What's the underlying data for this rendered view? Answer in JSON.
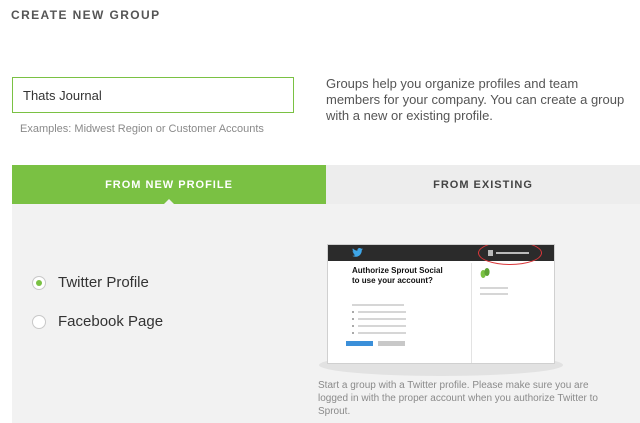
{
  "page": {
    "title": "CREATE NEW GROUP"
  },
  "group_name": {
    "value": "Thats Journal",
    "hint": "Examples: Midwest Region or Customer Accounts"
  },
  "description": "Groups help you organize profiles and team members for your company. You can create a group with a new or existing profile.",
  "tabs": [
    {
      "label": "FROM NEW PROFILE",
      "active": true
    },
    {
      "label": "FROM EXISTING",
      "active": false
    }
  ],
  "profile_options": [
    {
      "label": "Twitter Profile",
      "selected": true
    },
    {
      "label": "Facebook Page",
      "selected": false
    }
  ],
  "preview": {
    "heading": "Authorize Sprout Social to use your account?",
    "icons": [
      "twitter-icon",
      "sprout-social-icon"
    ]
  },
  "caption": "Start a group with a Twitter profile. Please make sure you are logged in with the proper account when you authorize Twitter to Sprout.",
  "colors": {
    "accent": "#7ac143",
    "tab_inactive": "#ededed",
    "panel_bg": "#f2f2f2",
    "highlight": "#d9373a",
    "preview_button": "#3b8fd9"
  }
}
